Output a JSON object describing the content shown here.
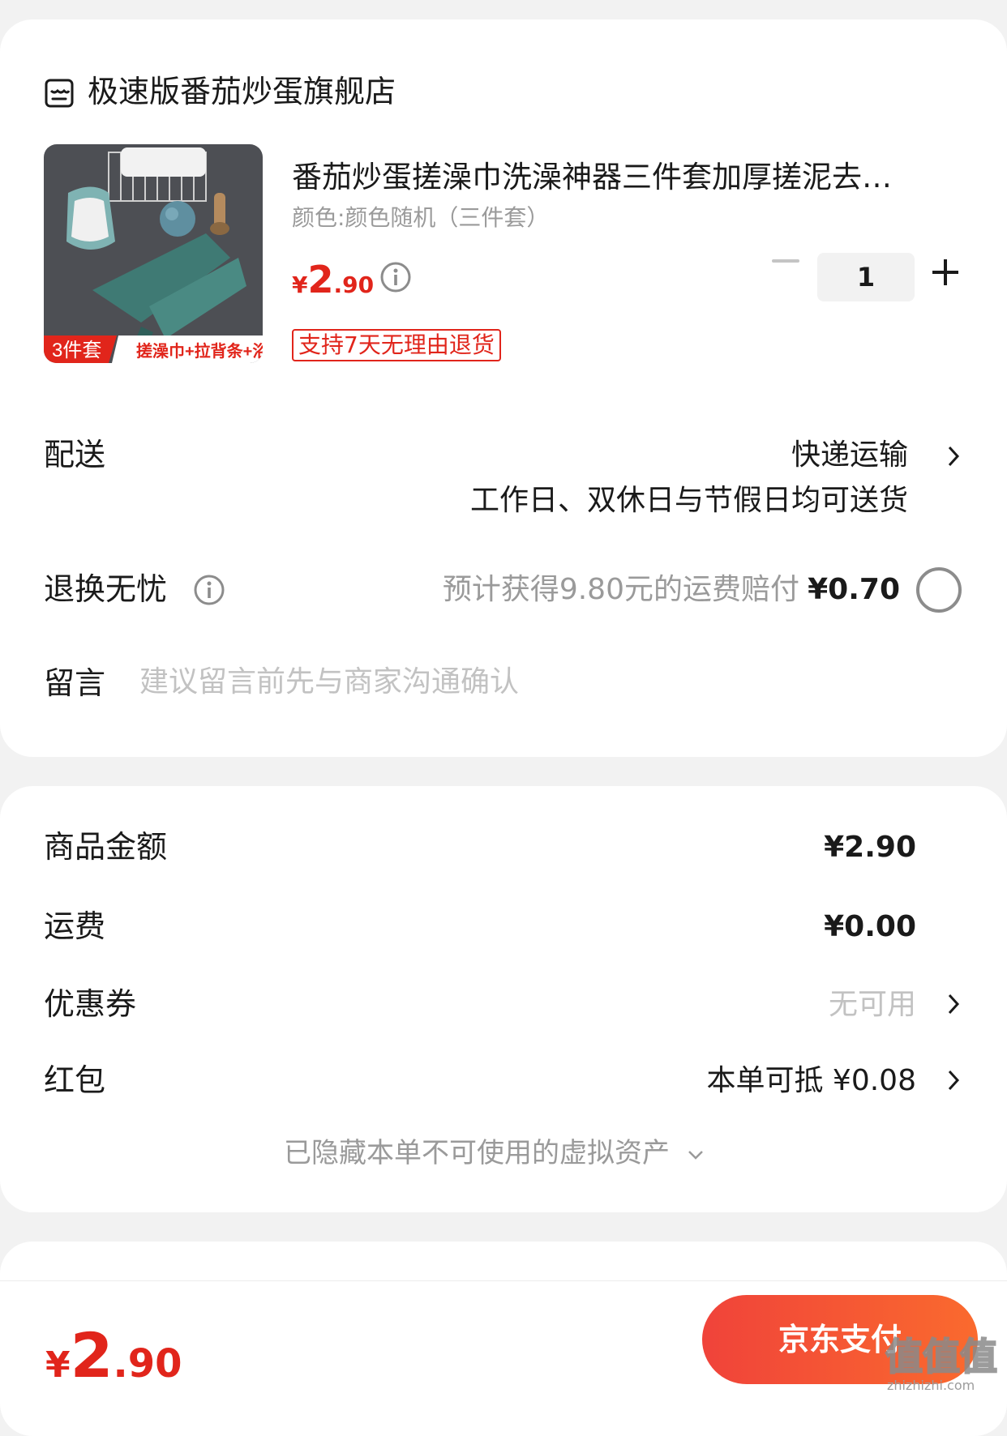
{
  "store": {
    "name": "极速版番茄炒蛋旗舰店",
    "icon": "store-icon"
  },
  "product": {
    "title": "番茄炒蛋搓澡巾洗澡神器三件套加厚搓泥去…",
    "spec": "颜色:颜色随机（三件套）",
    "price_currency": "¥",
    "price_int": "2",
    "price_dec": ".90",
    "quantity": "1",
    "return_tag": "支持7天无理由退货",
    "thumb_badge": "3件套",
    "thumb_caption": "搓澡巾+拉背条+浴花"
  },
  "delivery": {
    "label": "配送",
    "method": "快递运输",
    "schedule": "工作日、双休日与节假日均可送货"
  },
  "return_worry_free": {
    "label": "退换无忧",
    "estimate": "预计获得9.80元的运费赔付",
    "price": "¥0.70"
  },
  "message": {
    "label": "留言",
    "placeholder": "建议留言前先与商家沟通确认"
  },
  "costs": {
    "goods_label": "商品金额",
    "goods_value": "¥2.90",
    "shipping_label": "运费",
    "shipping_value": "¥0.00",
    "coupon_label": "优惠券",
    "coupon_value": "无可用",
    "redpacket_label": "红包",
    "redpacket_value": "本单可抵 ¥0.08",
    "hidden_assets": "已隐藏本单不可使用的虚拟资产"
  },
  "footer": {
    "currency": "¥",
    "total_int": "2",
    "total_dec": ".90",
    "pay_label": "京东支付",
    "watermark": "值值值",
    "watermark_url": "zhizhizhi.com"
  },
  "colors": {
    "accent": "#e1251b",
    "background": "#f2f2f2"
  }
}
